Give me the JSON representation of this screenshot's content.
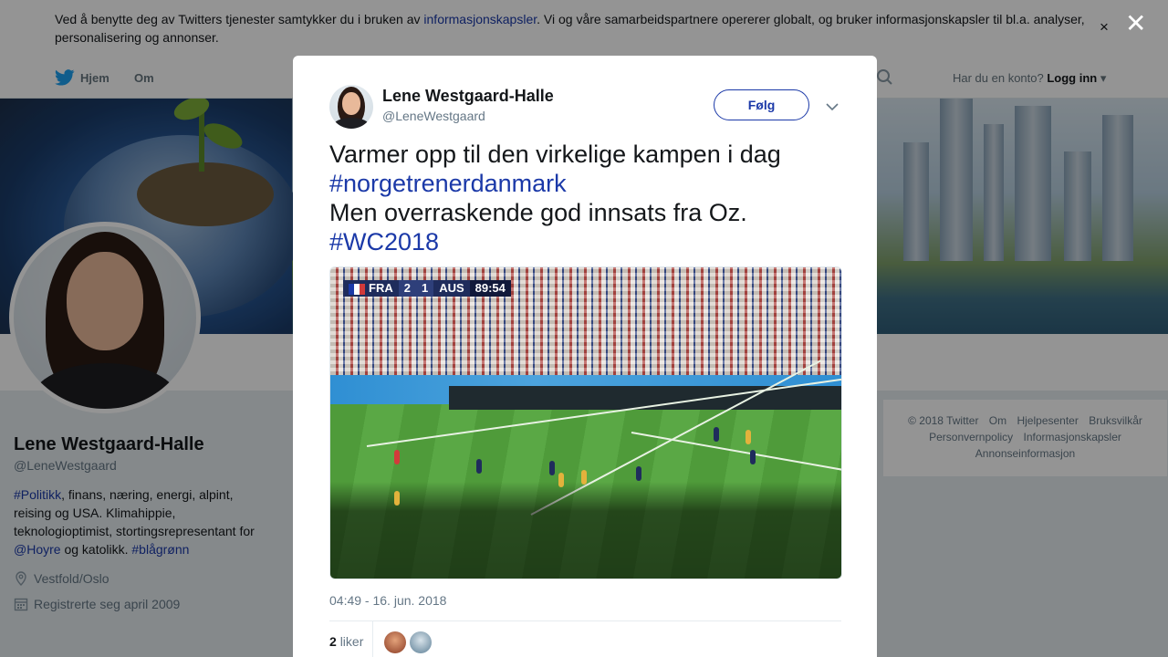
{
  "cookie_banner": {
    "text_before": "Ved å benytte deg av Twitters tjenester samtykker du i bruken av ",
    "link": "informasjonskapsler",
    "text_after": ". Vi og våre samarbeidspartnere opererer globalt, og bruker informasjonskapsler til bl.a. analyser, personalisering og annonser.",
    "close_glyph": "×"
  },
  "nav": {
    "home": "Hjem",
    "about": "Om",
    "account_prompt": "Har du en konto?",
    "login": "Logg inn"
  },
  "profile": {
    "name": "Lene Westgaard-Halle",
    "handle": "@LeneWestgaard",
    "bio": {
      "tag1": "#Politikk",
      "text1": ", finans, næring, energi, alpint, reising og USA. Klimahippie, teknologioptimist, stortingsrepresentant for ",
      "mention": "@Hoyre",
      "text2": " og katolikk. ",
      "tag2": "#blågrønn"
    },
    "location": "Vestfold/Oslo",
    "joined": "Registrerte seg april 2009"
  },
  "footer": {
    "links": [
      "© 2018 Twitter",
      "Om",
      "Hjelpesenter",
      "Bruksvilkår",
      "Personvernpolicy",
      "Informasjonskapsler",
      "Annonseinformasjon"
    ]
  },
  "modal": {
    "close_glyph": "✕",
    "author_name": "Lene Westgaard-Halle",
    "author_handle": "@LeneWestgaard",
    "follow_label": "Følg",
    "tweet": {
      "line1": "Varmer opp til den virkelige kampen i dag",
      "tag1": "#norgetrenerdanmark",
      "line2": "Men overraskende god innsats fra Oz.",
      "tag2": "#WC2018"
    },
    "scoreboard": {
      "home": "FRA",
      "home_score": "2",
      "away_score": "1",
      "away": "AUS",
      "clock": "89:54"
    },
    "timestamp": "04:49 - 16. jun. 2018",
    "likes_count": "2",
    "likes_label": "liker"
  },
  "colors": {
    "link": "#1b39a8",
    "muted": "#657786"
  }
}
